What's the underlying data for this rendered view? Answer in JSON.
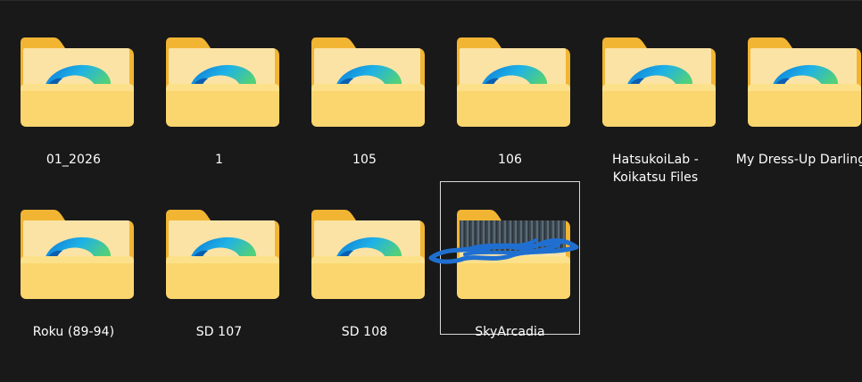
{
  "explorer": {
    "items": [
      {
        "name": "01_2026",
        "thumb": "browser-icon"
      },
      {
        "name": "1",
        "thumb": "browser-icon"
      },
      {
        "name": "105",
        "thumb": "browser-icon"
      },
      {
        "name": "106",
        "thumb": "browser-icon"
      },
      {
        "name": "HatsukoiLab - Koikatsu Files",
        "thumb": "browser-icon"
      },
      {
        "name": "My Dress-Up Darling",
        "thumb": "browser-icon"
      },
      {
        "name": "Roku (89-94)",
        "thumb": "browser-icon"
      },
      {
        "name": "SD 107",
        "thumb": "browser-icon"
      },
      {
        "name": "SD 108",
        "thumb": "browser-icon"
      },
      {
        "name": "SkyArcadia",
        "thumb": "image-preview",
        "selected": true
      }
    ]
  },
  "colors": {
    "background": "#191919",
    "folder_back": "#f2b533",
    "folder_front": "#fbd66e",
    "selection_outline": "#d9d9d9",
    "scribble": "#1f6fd1"
  }
}
